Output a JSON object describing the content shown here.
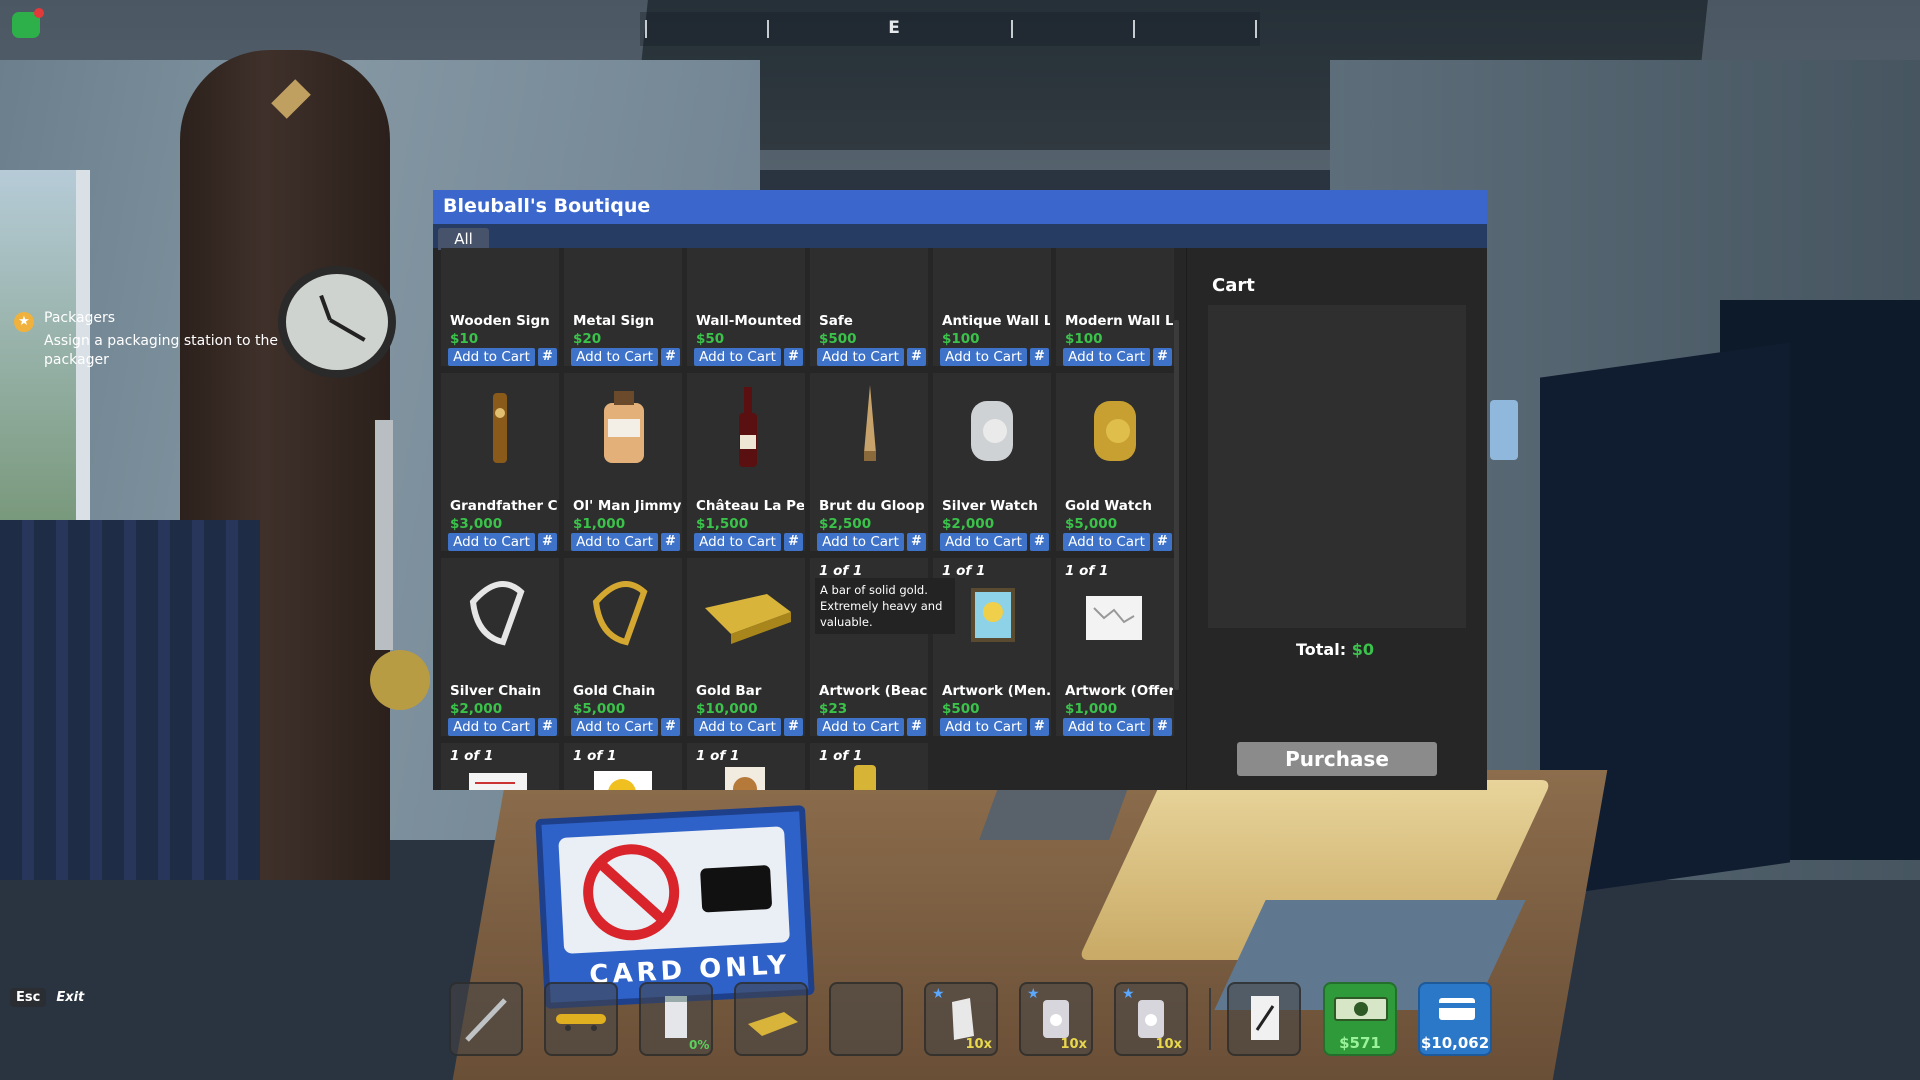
{
  "hud": {
    "compass_dir": "E",
    "quest": {
      "title": "Packagers",
      "text": "Assign a packaging station to the packager"
    },
    "esc_key": "Esc",
    "esc_label": "Exit"
  },
  "scene": {
    "sign_text": "CARD ONLY"
  },
  "shop": {
    "title": "Bleuball's Boutique",
    "tab": "All",
    "add_label": "Add to Cart",
    "qty_label": "#",
    "items": [
      {
        "name": "Wooden Sign",
        "price": "$10",
        "stock": ""
      },
      {
        "name": "Metal Sign",
        "price": "$20",
        "stock": ""
      },
      {
        "name": "Wall-Mounted ...",
        "price": "$50",
        "stock": ""
      },
      {
        "name": "Safe",
        "price": "$500",
        "stock": ""
      },
      {
        "name": "Antique Wall L...",
        "price": "$100",
        "stock": ""
      },
      {
        "name": "Modern Wall L...",
        "price": "$100",
        "stock": ""
      },
      {
        "name": "Grandfather Cl...",
        "price": "$3,000",
        "stock": ""
      },
      {
        "name": "Ol' Man Jimmy's",
        "price": "$1,000",
        "stock": ""
      },
      {
        "name": "Château La Pe...",
        "price": "$1,500",
        "stock": ""
      },
      {
        "name": "Brut du Gloop",
        "price": "$2,500",
        "stock": ""
      },
      {
        "name": "Silver Watch",
        "price": "$2,000",
        "stock": ""
      },
      {
        "name": "Gold Watch",
        "price": "$5,000",
        "stock": ""
      },
      {
        "name": "Silver Chain",
        "price": "$2,000",
        "stock": ""
      },
      {
        "name": "Gold Chain",
        "price": "$5,000",
        "stock": ""
      },
      {
        "name": "Gold Bar",
        "price": "$10,000",
        "stock": ""
      },
      {
        "name": "Artwork (Beac...",
        "price": "$23",
        "stock": "1 of 1"
      },
      {
        "name": "Artwork (Men...",
        "price": "$500",
        "stock": "1 of 1"
      },
      {
        "name": "Artwork (Offer)",
        "price": "$1,000",
        "stock": "1 of 1"
      },
      {
        "name": "",
        "price": "",
        "stock": "1 of 1"
      },
      {
        "name": "",
        "price": "",
        "stock": "1 of 1"
      },
      {
        "name": "",
        "price": "",
        "stock": "1 of 1"
      },
      {
        "name": "",
        "price": "",
        "stock": "1 of 1"
      }
    ],
    "tooltip": "A bar of solid gold. Extremely heavy and valuable.",
    "cart": {
      "title": "Cart",
      "total_label": "Total:",
      "total_value": "$0",
      "purchase_label": "Purchase"
    }
  },
  "hotbar": {
    "slots": [
      {
        "icon": "baton-icon"
      },
      {
        "icon": "skateboard-icon"
      },
      {
        "icon": "jar-icon",
        "percent": "0%"
      },
      {
        "icon": "gold-bar-icon"
      },
      {
        "icon": "empty-slot"
      },
      {
        "icon": "weed-bag-icon",
        "qty": "10x"
      },
      {
        "icon": "pack-icon",
        "qty": "10x"
      },
      {
        "icon": "pack-icon",
        "qty": "10x"
      },
      {
        "icon": "notepad-icon"
      }
    ],
    "cash": "$571",
    "bank": "$10,062"
  },
  "colors": {
    "title_bar": "#3b67cc",
    "tab_bar": "#263c63",
    "button": "#3e73c9",
    "price_green": "#3ac24a",
    "panel_bg": "#262626"
  }
}
